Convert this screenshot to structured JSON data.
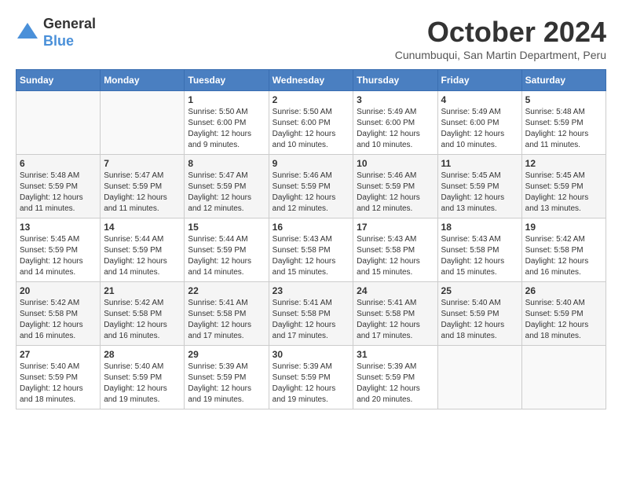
{
  "logo": {
    "general": "General",
    "blue": "Blue"
  },
  "title": "October 2024",
  "subtitle": "Cunumbuqui, San Martin Department, Peru",
  "weekdays": [
    "Sunday",
    "Monday",
    "Tuesday",
    "Wednesday",
    "Thursday",
    "Friday",
    "Saturday"
  ],
  "weeks": [
    [
      {
        "day": "",
        "info": ""
      },
      {
        "day": "",
        "info": ""
      },
      {
        "day": "1",
        "info": "Sunrise: 5:50 AM\nSunset: 6:00 PM\nDaylight: 12 hours\nand 9 minutes."
      },
      {
        "day": "2",
        "info": "Sunrise: 5:50 AM\nSunset: 6:00 PM\nDaylight: 12 hours\nand 10 minutes."
      },
      {
        "day": "3",
        "info": "Sunrise: 5:49 AM\nSunset: 6:00 PM\nDaylight: 12 hours\nand 10 minutes."
      },
      {
        "day": "4",
        "info": "Sunrise: 5:49 AM\nSunset: 6:00 PM\nDaylight: 12 hours\nand 10 minutes."
      },
      {
        "day": "5",
        "info": "Sunrise: 5:48 AM\nSunset: 5:59 PM\nDaylight: 12 hours\nand 11 minutes."
      }
    ],
    [
      {
        "day": "6",
        "info": "Sunrise: 5:48 AM\nSunset: 5:59 PM\nDaylight: 12 hours\nand 11 minutes."
      },
      {
        "day": "7",
        "info": "Sunrise: 5:47 AM\nSunset: 5:59 PM\nDaylight: 12 hours\nand 11 minutes."
      },
      {
        "day": "8",
        "info": "Sunrise: 5:47 AM\nSunset: 5:59 PM\nDaylight: 12 hours\nand 12 minutes."
      },
      {
        "day": "9",
        "info": "Sunrise: 5:46 AM\nSunset: 5:59 PM\nDaylight: 12 hours\nand 12 minutes."
      },
      {
        "day": "10",
        "info": "Sunrise: 5:46 AM\nSunset: 5:59 PM\nDaylight: 12 hours\nand 12 minutes."
      },
      {
        "day": "11",
        "info": "Sunrise: 5:45 AM\nSunset: 5:59 PM\nDaylight: 12 hours\nand 13 minutes."
      },
      {
        "day": "12",
        "info": "Sunrise: 5:45 AM\nSunset: 5:59 PM\nDaylight: 12 hours\nand 13 minutes."
      }
    ],
    [
      {
        "day": "13",
        "info": "Sunrise: 5:45 AM\nSunset: 5:59 PM\nDaylight: 12 hours\nand 14 minutes."
      },
      {
        "day": "14",
        "info": "Sunrise: 5:44 AM\nSunset: 5:59 PM\nDaylight: 12 hours\nand 14 minutes."
      },
      {
        "day": "15",
        "info": "Sunrise: 5:44 AM\nSunset: 5:59 PM\nDaylight: 12 hours\nand 14 minutes."
      },
      {
        "day": "16",
        "info": "Sunrise: 5:43 AM\nSunset: 5:58 PM\nDaylight: 12 hours\nand 15 minutes."
      },
      {
        "day": "17",
        "info": "Sunrise: 5:43 AM\nSunset: 5:58 PM\nDaylight: 12 hours\nand 15 minutes."
      },
      {
        "day": "18",
        "info": "Sunrise: 5:43 AM\nSunset: 5:58 PM\nDaylight: 12 hours\nand 15 minutes."
      },
      {
        "day": "19",
        "info": "Sunrise: 5:42 AM\nSunset: 5:58 PM\nDaylight: 12 hours\nand 16 minutes."
      }
    ],
    [
      {
        "day": "20",
        "info": "Sunrise: 5:42 AM\nSunset: 5:58 PM\nDaylight: 12 hours\nand 16 minutes."
      },
      {
        "day": "21",
        "info": "Sunrise: 5:42 AM\nSunset: 5:58 PM\nDaylight: 12 hours\nand 16 minutes."
      },
      {
        "day": "22",
        "info": "Sunrise: 5:41 AM\nSunset: 5:58 PM\nDaylight: 12 hours\nand 17 minutes."
      },
      {
        "day": "23",
        "info": "Sunrise: 5:41 AM\nSunset: 5:58 PM\nDaylight: 12 hours\nand 17 minutes."
      },
      {
        "day": "24",
        "info": "Sunrise: 5:41 AM\nSunset: 5:58 PM\nDaylight: 12 hours\nand 17 minutes."
      },
      {
        "day": "25",
        "info": "Sunrise: 5:40 AM\nSunset: 5:59 PM\nDaylight: 12 hours\nand 18 minutes."
      },
      {
        "day": "26",
        "info": "Sunrise: 5:40 AM\nSunset: 5:59 PM\nDaylight: 12 hours\nand 18 minutes."
      }
    ],
    [
      {
        "day": "27",
        "info": "Sunrise: 5:40 AM\nSunset: 5:59 PM\nDaylight: 12 hours\nand 18 minutes."
      },
      {
        "day": "28",
        "info": "Sunrise: 5:40 AM\nSunset: 5:59 PM\nDaylight: 12 hours\nand 19 minutes."
      },
      {
        "day": "29",
        "info": "Sunrise: 5:39 AM\nSunset: 5:59 PM\nDaylight: 12 hours\nand 19 minutes."
      },
      {
        "day": "30",
        "info": "Sunrise: 5:39 AM\nSunset: 5:59 PM\nDaylight: 12 hours\nand 19 minutes."
      },
      {
        "day": "31",
        "info": "Sunrise: 5:39 AM\nSunset: 5:59 PM\nDaylight: 12 hours\nand 20 minutes."
      },
      {
        "day": "",
        "info": ""
      },
      {
        "day": "",
        "info": ""
      }
    ]
  ]
}
